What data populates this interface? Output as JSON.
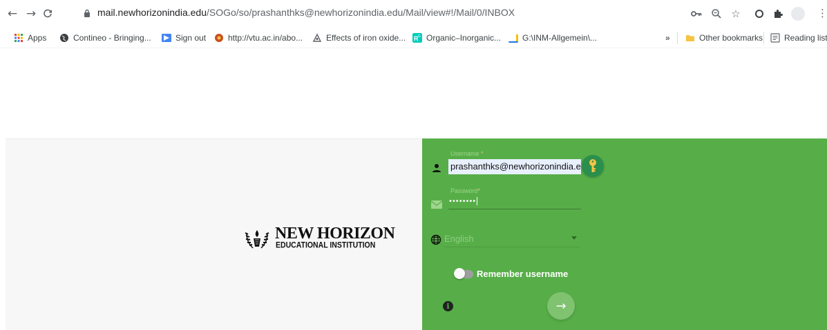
{
  "browser": {
    "url_host": "mail.newhorizonindia.edu",
    "url_path": "/SOGo/so/prashanthks@newhorizonindia.edu/Mail/view#!/Mail/0/INBOX",
    "nav": {
      "back_icon": "←",
      "forward_icon": "→",
      "reload_icon": "C"
    },
    "toolbar_icons": {
      "key_icon": "⊶",
      "zoom_icon": "⌕",
      "star_icon": "☆",
      "extension_icon": "◯",
      "puzzle_icon": "✱",
      "menu_icon": "⋮"
    }
  },
  "bookmarks": {
    "items": [
      {
        "label": "Apps",
        "icon": "apps-grid-icon",
        "color": "#e94235"
      },
      {
        "label": "Contineo - Bringing...",
        "icon": "globe-icon",
        "color": "#3c4043"
      },
      {
        "label": "Sign out",
        "icon": "signout-icon",
        "color": "#4285f4"
      },
      {
        "label": "http://vtu.ac.in/abo...",
        "icon": "vtu-icon",
        "color": "#c9501c"
      },
      {
        "label": "Effects of iron oxide...",
        "icon": "article-icon",
        "color": "#5f6368"
      },
      {
        "label": "Organic–Inorganic...",
        "icon": "researchgate-icon",
        "color": "#00ccbb"
      },
      {
        "label": "G:\\INM-Allgemein\\...",
        "icon": "chart-icon",
        "color": "#1a73e8"
      }
    ],
    "overflow": "»",
    "other_bookmarks": "Other bookmarks",
    "reading_list": "Reading list"
  },
  "logo": {
    "line1": "NEW HORIZON",
    "line2": "EDUCATIONAL INSTITUTION"
  },
  "login": {
    "username_label": "Username",
    "username_value": "prashanthks@newhorizonindia.ed",
    "password_label": "Password",
    "password_value": "••••••••",
    "required_mark": "*",
    "language_value": "English",
    "remember_label": "Remember username",
    "remember_checked": false,
    "submit_icon": "→",
    "info_icon": "i"
  },
  "colors": {
    "panel_green": "#57ae48",
    "submit_green": "#7fc270",
    "key_button": "#2a8f4c",
    "autofill_bg": "#e8f0fe"
  }
}
